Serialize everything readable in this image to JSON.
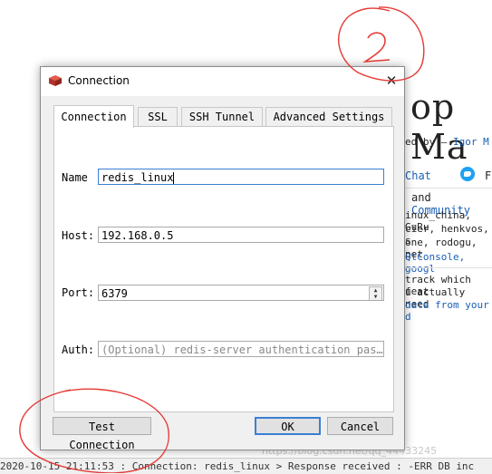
{
  "background": {
    "title": "op Ma",
    "byline": "ed by – ",
    "author": "Igor M",
    "chat_link": "Chat",
    "twitter_letter": "F",
    "and_text": "and",
    "community_link": "Community",
    "contributors_line1": "inux_china, GuRu",
    "contributors_line2": "cier, henkvos, s",
    "contributors_line3": "one, rodogu, pet",
    "links_line": "QtConsole, googl",
    "track_line1": "track which feat",
    "track_line2": "u actually need",
    "track_line3": "data from your d",
    "statusbar": "2020-10-15 21:11:53 : Connection: redis_linux > Response received : -ERR DB inc",
    "watermark": "https://blog.csdn.net/qq_44433245"
  },
  "dialog": {
    "title": "Connection",
    "close_glyph": "✕",
    "tabs": [
      {
        "label": "Connection",
        "active": true
      },
      {
        "label": "SSL",
        "active": false
      },
      {
        "label": "SSH Tunnel",
        "active": false
      },
      {
        "label": "Advanced Settings",
        "active": false
      }
    ],
    "fields": {
      "name_label": "Name",
      "name_value": "redis_linux",
      "host_label": "Host:",
      "host_value": "192.168.0.5",
      "port_label": "Port:",
      "port_value": "6379",
      "auth_label": "Auth:",
      "auth_placeholder": "(Optional) redis-server authentication pas…"
    },
    "buttons": {
      "test": "Test Connection",
      "ok": "OK",
      "cancel": "Cancel"
    }
  },
  "annotations": {
    "number_label": "2",
    "color": "#e53935"
  },
  "colors": {
    "focus_border": "#3b7fd4",
    "link": "#1a5fb4",
    "twitter": "#1da1f2",
    "icon_red": "#c0392b"
  }
}
